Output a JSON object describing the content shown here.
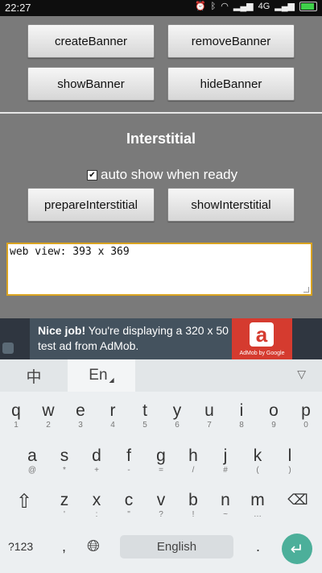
{
  "statusbar": {
    "time": "22:27",
    "network": "4G"
  },
  "buttons": {
    "create_banner": "createBanner",
    "remove_banner": "removeBanner",
    "show_banner": "showBanner",
    "hide_banner": "hideBanner",
    "prepare_interstitial": "prepareInterstitial",
    "show_interstitial": "showInterstitial"
  },
  "interstitial": {
    "title": "Interstitial",
    "auto_show_label": "auto show when ready",
    "auto_show_checked": true
  },
  "webview": {
    "text": "web view: 393 x 369"
  },
  "ad": {
    "bold": "Nice job!",
    "text": " You're displaying a 320 x 50 test ad from AdMob.",
    "logo_text": "AdMob by Google",
    "logo_glyph": "a"
  },
  "keyboard": {
    "tab_chinese": "中",
    "tab_english": "En",
    "row1": [
      {
        "main": "q",
        "sub": "1"
      },
      {
        "main": "w",
        "sub": "2"
      },
      {
        "main": "e",
        "sub": "3"
      },
      {
        "main": "r",
        "sub": "4"
      },
      {
        "main": "t",
        "sub": "5"
      },
      {
        "main": "y",
        "sub": "6"
      },
      {
        "main": "u",
        "sub": "7"
      },
      {
        "main": "i",
        "sub": "8"
      },
      {
        "main": "o",
        "sub": "9"
      },
      {
        "main": "p",
        "sub": "0"
      }
    ],
    "row2": [
      {
        "main": "a",
        "sub": "@"
      },
      {
        "main": "s",
        "sub": "*"
      },
      {
        "main": "d",
        "sub": "+"
      },
      {
        "main": "f",
        "sub": "-"
      },
      {
        "main": "g",
        "sub": "="
      },
      {
        "main": "h",
        "sub": "/"
      },
      {
        "main": "j",
        "sub": "#"
      },
      {
        "main": "k",
        "sub": "("
      },
      {
        "main": "l",
        "sub": ")"
      }
    ],
    "row3": [
      {
        "main": "z",
        "sub": "'"
      },
      {
        "main": "x",
        "sub": ":"
      },
      {
        "main": "c",
        "sub": "\""
      },
      {
        "main": "v",
        "sub": "?"
      },
      {
        "main": "b",
        "sub": "!"
      },
      {
        "main": "n",
        "sub": "~"
      },
      {
        "main": "m",
        "sub": "…"
      }
    ],
    "symbols_label": "?123",
    "comma": ",",
    "space_label": "English",
    "period": "."
  }
}
